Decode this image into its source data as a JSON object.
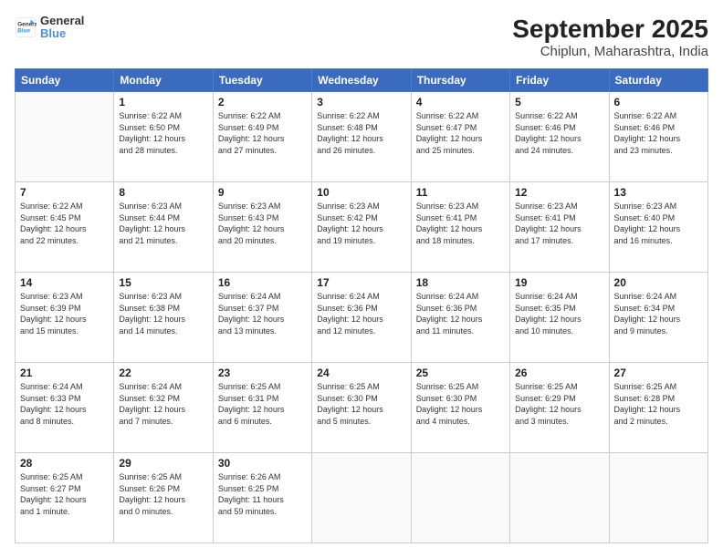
{
  "header": {
    "logo_line1": "General",
    "logo_line2": "Blue",
    "title": "September 2025",
    "subtitle": "Chiplun, Maharashtra, India"
  },
  "days_of_week": [
    "Sunday",
    "Monday",
    "Tuesday",
    "Wednesday",
    "Thursday",
    "Friday",
    "Saturday"
  ],
  "weeks": [
    [
      {
        "num": "",
        "info": ""
      },
      {
        "num": "1",
        "info": "Sunrise: 6:22 AM\nSunset: 6:50 PM\nDaylight: 12 hours\nand 28 minutes."
      },
      {
        "num": "2",
        "info": "Sunrise: 6:22 AM\nSunset: 6:49 PM\nDaylight: 12 hours\nand 27 minutes."
      },
      {
        "num": "3",
        "info": "Sunrise: 6:22 AM\nSunset: 6:48 PM\nDaylight: 12 hours\nand 26 minutes."
      },
      {
        "num": "4",
        "info": "Sunrise: 6:22 AM\nSunset: 6:47 PM\nDaylight: 12 hours\nand 25 minutes."
      },
      {
        "num": "5",
        "info": "Sunrise: 6:22 AM\nSunset: 6:46 PM\nDaylight: 12 hours\nand 24 minutes."
      },
      {
        "num": "6",
        "info": "Sunrise: 6:22 AM\nSunset: 6:46 PM\nDaylight: 12 hours\nand 23 minutes."
      }
    ],
    [
      {
        "num": "7",
        "info": "Sunrise: 6:22 AM\nSunset: 6:45 PM\nDaylight: 12 hours\nand 22 minutes."
      },
      {
        "num": "8",
        "info": "Sunrise: 6:23 AM\nSunset: 6:44 PM\nDaylight: 12 hours\nand 21 minutes."
      },
      {
        "num": "9",
        "info": "Sunrise: 6:23 AM\nSunset: 6:43 PM\nDaylight: 12 hours\nand 20 minutes."
      },
      {
        "num": "10",
        "info": "Sunrise: 6:23 AM\nSunset: 6:42 PM\nDaylight: 12 hours\nand 19 minutes."
      },
      {
        "num": "11",
        "info": "Sunrise: 6:23 AM\nSunset: 6:41 PM\nDaylight: 12 hours\nand 18 minutes."
      },
      {
        "num": "12",
        "info": "Sunrise: 6:23 AM\nSunset: 6:41 PM\nDaylight: 12 hours\nand 17 minutes."
      },
      {
        "num": "13",
        "info": "Sunrise: 6:23 AM\nSunset: 6:40 PM\nDaylight: 12 hours\nand 16 minutes."
      }
    ],
    [
      {
        "num": "14",
        "info": "Sunrise: 6:23 AM\nSunset: 6:39 PM\nDaylight: 12 hours\nand 15 minutes."
      },
      {
        "num": "15",
        "info": "Sunrise: 6:23 AM\nSunset: 6:38 PM\nDaylight: 12 hours\nand 14 minutes."
      },
      {
        "num": "16",
        "info": "Sunrise: 6:24 AM\nSunset: 6:37 PM\nDaylight: 12 hours\nand 13 minutes."
      },
      {
        "num": "17",
        "info": "Sunrise: 6:24 AM\nSunset: 6:36 PM\nDaylight: 12 hours\nand 12 minutes."
      },
      {
        "num": "18",
        "info": "Sunrise: 6:24 AM\nSunset: 6:36 PM\nDaylight: 12 hours\nand 11 minutes."
      },
      {
        "num": "19",
        "info": "Sunrise: 6:24 AM\nSunset: 6:35 PM\nDaylight: 12 hours\nand 10 minutes."
      },
      {
        "num": "20",
        "info": "Sunrise: 6:24 AM\nSunset: 6:34 PM\nDaylight: 12 hours\nand 9 minutes."
      }
    ],
    [
      {
        "num": "21",
        "info": "Sunrise: 6:24 AM\nSunset: 6:33 PM\nDaylight: 12 hours\nand 8 minutes."
      },
      {
        "num": "22",
        "info": "Sunrise: 6:24 AM\nSunset: 6:32 PM\nDaylight: 12 hours\nand 7 minutes."
      },
      {
        "num": "23",
        "info": "Sunrise: 6:25 AM\nSunset: 6:31 PM\nDaylight: 12 hours\nand 6 minutes."
      },
      {
        "num": "24",
        "info": "Sunrise: 6:25 AM\nSunset: 6:30 PM\nDaylight: 12 hours\nand 5 minutes."
      },
      {
        "num": "25",
        "info": "Sunrise: 6:25 AM\nSunset: 6:30 PM\nDaylight: 12 hours\nand 4 minutes."
      },
      {
        "num": "26",
        "info": "Sunrise: 6:25 AM\nSunset: 6:29 PM\nDaylight: 12 hours\nand 3 minutes."
      },
      {
        "num": "27",
        "info": "Sunrise: 6:25 AM\nSunset: 6:28 PM\nDaylight: 12 hours\nand 2 minutes."
      }
    ],
    [
      {
        "num": "28",
        "info": "Sunrise: 6:25 AM\nSunset: 6:27 PM\nDaylight: 12 hours\nand 1 minute."
      },
      {
        "num": "29",
        "info": "Sunrise: 6:25 AM\nSunset: 6:26 PM\nDaylight: 12 hours\nand 0 minutes."
      },
      {
        "num": "30",
        "info": "Sunrise: 6:26 AM\nSunset: 6:25 PM\nDaylight: 11 hours\nand 59 minutes."
      },
      {
        "num": "",
        "info": ""
      },
      {
        "num": "",
        "info": ""
      },
      {
        "num": "",
        "info": ""
      },
      {
        "num": "",
        "info": ""
      }
    ]
  ]
}
